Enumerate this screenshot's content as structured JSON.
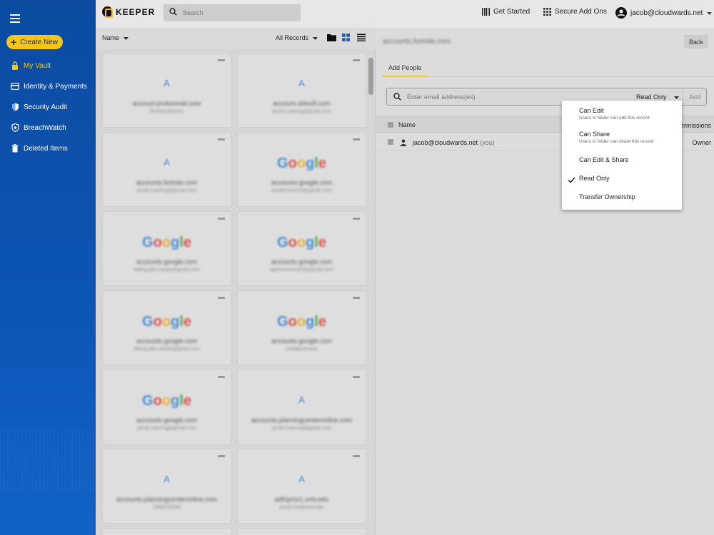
{
  "sidebar": {
    "create_label": "Create New",
    "items": [
      {
        "label": "My Vault",
        "icon": "lock-icon"
      },
      {
        "label": "Identity & Payments",
        "icon": "card-icon"
      },
      {
        "label": "Security Audit",
        "icon": "shield-icon"
      },
      {
        "label": "BreachWatch",
        "icon": "breachwatch-icon"
      },
      {
        "label": "Deleted Items",
        "icon": "trash-icon"
      }
    ],
    "accent_color": "#f5c518"
  },
  "topbar": {
    "brand": "KEEPER",
    "search_placeholder": "Search",
    "get_started": "Get Started",
    "secure_add_ons": "Secure Add Ons",
    "account": "jacob@cloudwards.net"
  },
  "list": {
    "sort_label": "Name",
    "filter_label": "All Records",
    "cards": [
      {
        "logo": "A",
        "title": "account.protonmail.com",
        "subtitle": "lfhelsoeyfjnskis"
      },
      {
        "logo": "A",
        "title": "account.ubisoft.com",
        "subtitle": "jacob.roaming@gmail.com"
      },
      {
        "logo": "A",
        "title": "accounts.fortnite.com",
        "subtitle": "jacob.roaming@gmail.com"
      },
      {
        "logo": "Google",
        "title": "accounts.google.com",
        "subtitle": "purpleoverlord@gmail.com"
      },
      {
        "logo": "Google",
        "title": "accounts.google.com",
        "subtitle": "billing.jake.studio@gmail.com"
      },
      {
        "logo": "Google",
        "title": "accounts.google.com",
        "subtitle": "Igamessound03@gmail.com"
      },
      {
        "logo": "Google",
        "title": "accounts.google.com",
        "subtitle": "billing.jake.studio@gmail.com"
      },
      {
        "logo": "Google",
        "title": "accounts.google.com",
        "subtitle": "smallauroraws"
      },
      {
        "logo": "Google",
        "title": "accounts.google.com",
        "subtitle": "jacob.roaming@gmail.com"
      },
      {
        "logo": "A",
        "title": "accounts.planningcenteronline.com",
        "subtitle": "jacob.roaming@gmail.com"
      },
      {
        "logo": "A",
        "title": "accounts.planningcenteronline.com",
        "subtitle": "2066232389"
      },
      {
        "logo": "A",
        "title": "adfsprox1.unlv.edu",
        "subtitle": "jacob.roa@unlv.edu"
      }
    ]
  },
  "detail": {
    "record_title": "accounts.fortnite.com",
    "back_label": "Back",
    "tab_label": "Add People",
    "email_placeholder": "Enter email address(es)",
    "permission_selected": "Read Only",
    "add_label": "Add",
    "col_name": "Name",
    "col_permissions": "Permissions",
    "row_email": "jacob@cloudwards.net",
    "row_you": "(you)",
    "row_permission": "Owner"
  },
  "menu": {
    "items": [
      {
        "label": "Can Edit",
        "sub": "Users in folder can edit this record"
      },
      {
        "label": "Can Share",
        "sub": "Users in folder can share this record"
      },
      {
        "label": "Can Edit & Share",
        "sub": ""
      },
      {
        "label": "Read Only",
        "sub": ""
      },
      {
        "label": "Transfer Ownership",
        "sub": ""
      }
    ],
    "selected": "Read Only"
  }
}
